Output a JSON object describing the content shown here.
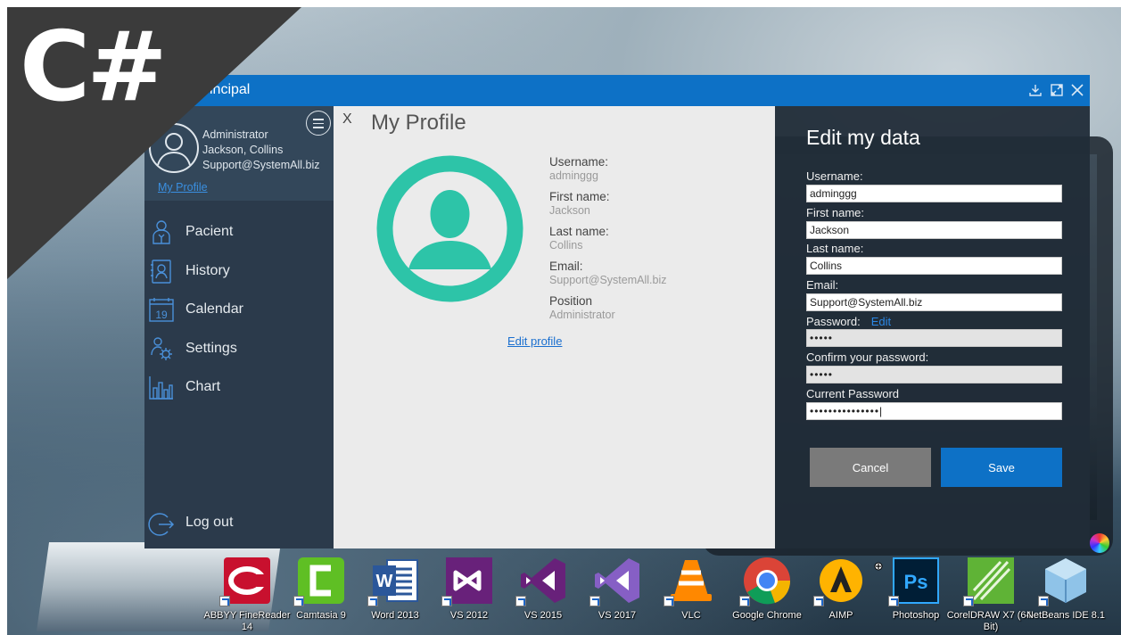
{
  "overlay": {
    "logo_text": "C#"
  },
  "window": {
    "title": "Principal",
    "controls": [
      "download-icon",
      "maximize-icon",
      "close-icon"
    ]
  },
  "sidebar": {
    "user": {
      "role": "Administrator",
      "name": "Jackson, Collins",
      "email": "Support@SystemAll.biz",
      "profile_link": "My Profile"
    },
    "items": [
      {
        "label": "Pacient",
        "icon": "patient-icon"
      },
      {
        "label": "History",
        "icon": "history-icon"
      },
      {
        "label": "Calendar",
        "icon": "calendar-icon",
        "icon_text": "19"
      },
      {
        "label": "Settings",
        "icon": "settings-icon"
      },
      {
        "label": "Chart",
        "icon": "chart-icon"
      }
    ],
    "logout_label": "Log out"
  },
  "profile": {
    "close_label": "X",
    "title": "My Profile",
    "fields": [
      {
        "label": "Username:",
        "value": "adminggg"
      },
      {
        "label": "First name:",
        "value": "Jackson"
      },
      {
        "label": "Last name:",
        "value": "Collins"
      },
      {
        "label": "Email:",
        "value": "Support@SystemAll.biz"
      },
      {
        "label": "Position",
        "value": "Administrator"
      }
    ],
    "edit_link": "Edit profile"
  },
  "edit_form": {
    "title": "Edit my data",
    "username_label": "Username:",
    "username": "adminggg",
    "firstname_label": "First name:",
    "firstname": "Jackson",
    "lastname_label": "Last name:",
    "lastname": "Collins",
    "email_label": "Email:",
    "email": "Support@SystemAll.biz",
    "password_label": "Password:",
    "password_edit_link": "Edit",
    "password": "•••••",
    "confirm_label": "Confirm your password:",
    "confirm": "•••••",
    "current_label": "Current Password",
    "current": "•••••••••••••••|",
    "cancel_label": "Cancel",
    "save_label": "Save"
  },
  "taskbar": [
    {
      "label": "ABBYY FineReader 14",
      "icon": "abbyy-icon",
      "color": "#c8102e"
    },
    {
      "label": "Camtasia 9",
      "icon": "camtasia-icon",
      "color": "#5fbf24"
    },
    {
      "label": "Word 2013",
      "icon": "word-icon",
      "color": "#2b579a"
    },
    {
      "label": "VS 2012",
      "icon": "vs2012-icon",
      "color": "#68217a"
    },
    {
      "label": "VS 2015",
      "icon": "vs2015-icon",
      "color": "#68217a"
    },
    {
      "label": "VS 2017",
      "icon": "vs2017-icon",
      "color": "#865fc5"
    },
    {
      "label": "VLC",
      "icon": "vlc-icon",
      "color": "#ff8800"
    },
    {
      "label": "Google Chrome",
      "icon": "chrome-icon",
      "color": "#4285f4"
    },
    {
      "label": "AIMP",
      "icon": "aimp-icon",
      "color": "#ffb300"
    },
    {
      "label": "Photoshop",
      "icon": "photoshop-icon",
      "color": "#31a8ff"
    },
    {
      "label": "CorelDRAW X7 (64-Bit)",
      "icon": "coreldraw-icon",
      "color": "#5fb336"
    },
    {
      "label": "NetBeans IDE 8.1",
      "icon": "netbeans-icon",
      "color": "#8fc3e8"
    }
  ],
  "colors": {
    "accent": "#0d71c6",
    "sidebar_bg": "#2b3a4b",
    "profile_bg": "#ebebeb",
    "avatar": "#2dc4a8",
    "edit_panel_bg": "#212c38"
  }
}
